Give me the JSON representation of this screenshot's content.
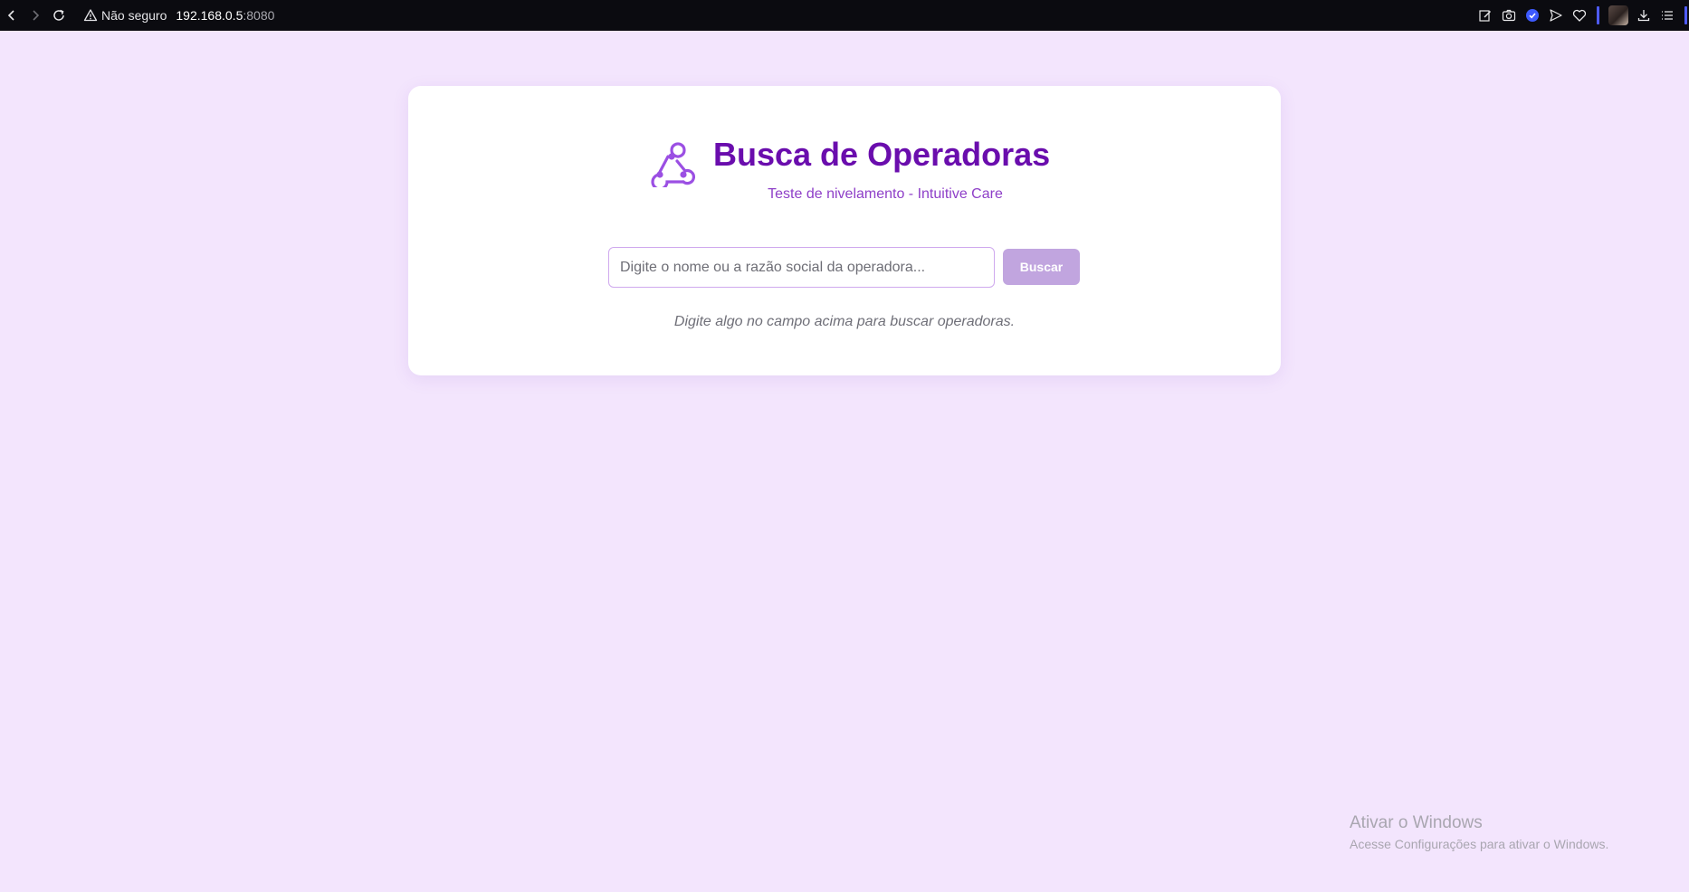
{
  "browser": {
    "security_label": "Não seguro",
    "url_host": "192.168.0.5",
    "url_port": ":8080",
    "icons": [
      "back-icon",
      "forward-icon",
      "reload-icon",
      "warning-icon",
      "edit-icon",
      "camera-icon",
      "shield-icon",
      "send-icon",
      "heart-icon",
      "download-icon",
      "menu-icon"
    ]
  },
  "page": {
    "title": "Busca de Operadoras",
    "subtitle": "Teste de nivelamento - Intuitive Care",
    "search": {
      "placeholder": "Digite o nome ou a razão social da operadora...",
      "value": "",
      "button_label": "Buscar"
    },
    "hint": "Digite algo no campo acima para buscar operadoras.",
    "colors": {
      "background": "#f3e5fd",
      "title": "#6a0dad",
      "subtitle": "#8e3fc8",
      "button": "#c1a5df"
    }
  },
  "os_overlay": {
    "title": "Ativar o Windows",
    "subtitle": "Acesse Configurações para ativar o Windows."
  }
}
